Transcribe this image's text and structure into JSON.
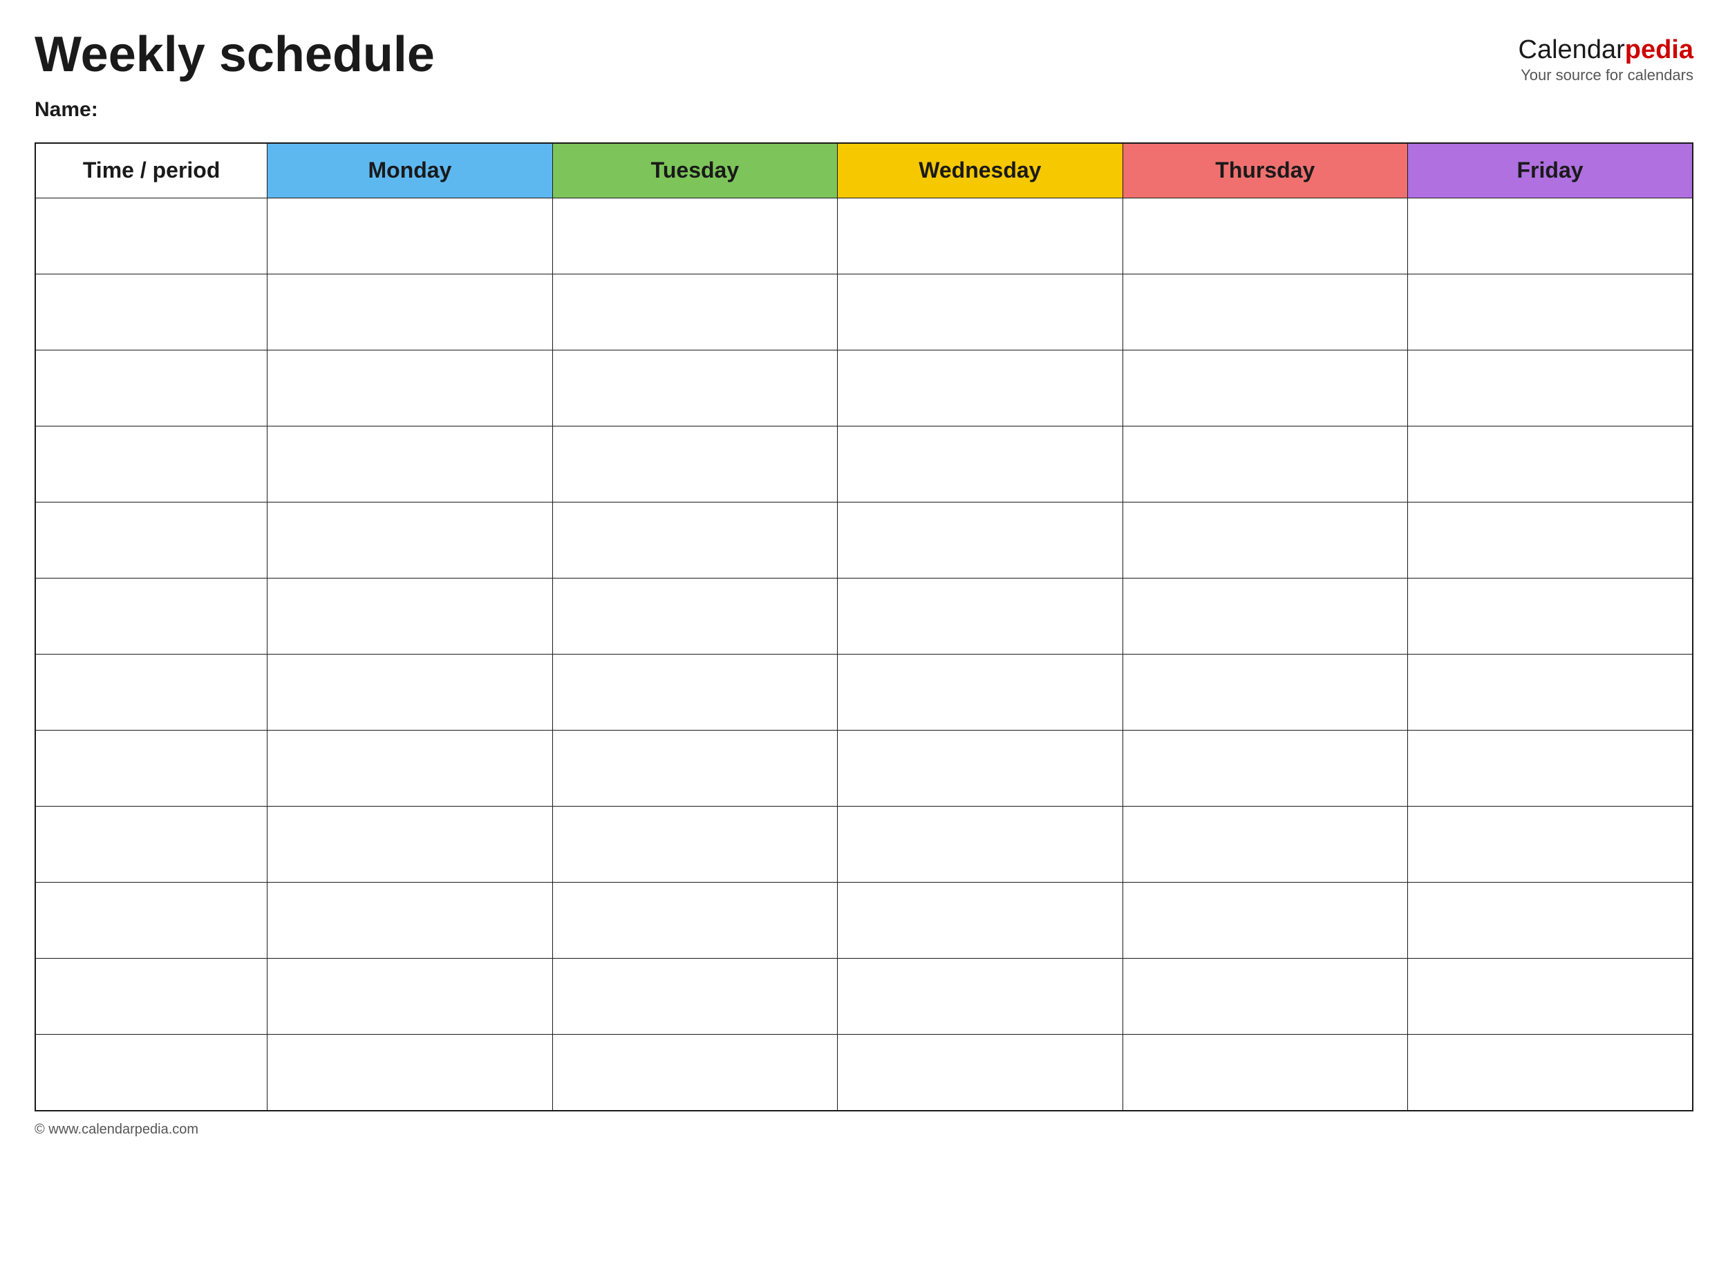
{
  "header": {
    "title": "Weekly schedule",
    "logo": {
      "calendar": "Calendar",
      "pedia": "pedia",
      "tagline": "Your source for calendars"
    }
  },
  "name_label": "Name:",
  "table": {
    "columns": [
      {
        "id": "time",
        "label": "Time / period",
        "color": "none"
      },
      {
        "id": "monday",
        "label": "Monday",
        "color": "#5eb8f0"
      },
      {
        "id": "tuesday",
        "label": "Tuesday",
        "color": "#7dc55a"
      },
      {
        "id": "wednesday",
        "label": "Wednesday",
        "color": "#f5c800"
      },
      {
        "id": "thursday",
        "label": "Thursday",
        "color": "#f07070"
      },
      {
        "id": "friday",
        "label": "Friday",
        "color": "#b070e0"
      }
    ],
    "row_count": 12
  },
  "footer": {
    "copyright": "© www.calendarpedia.com"
  }
}
